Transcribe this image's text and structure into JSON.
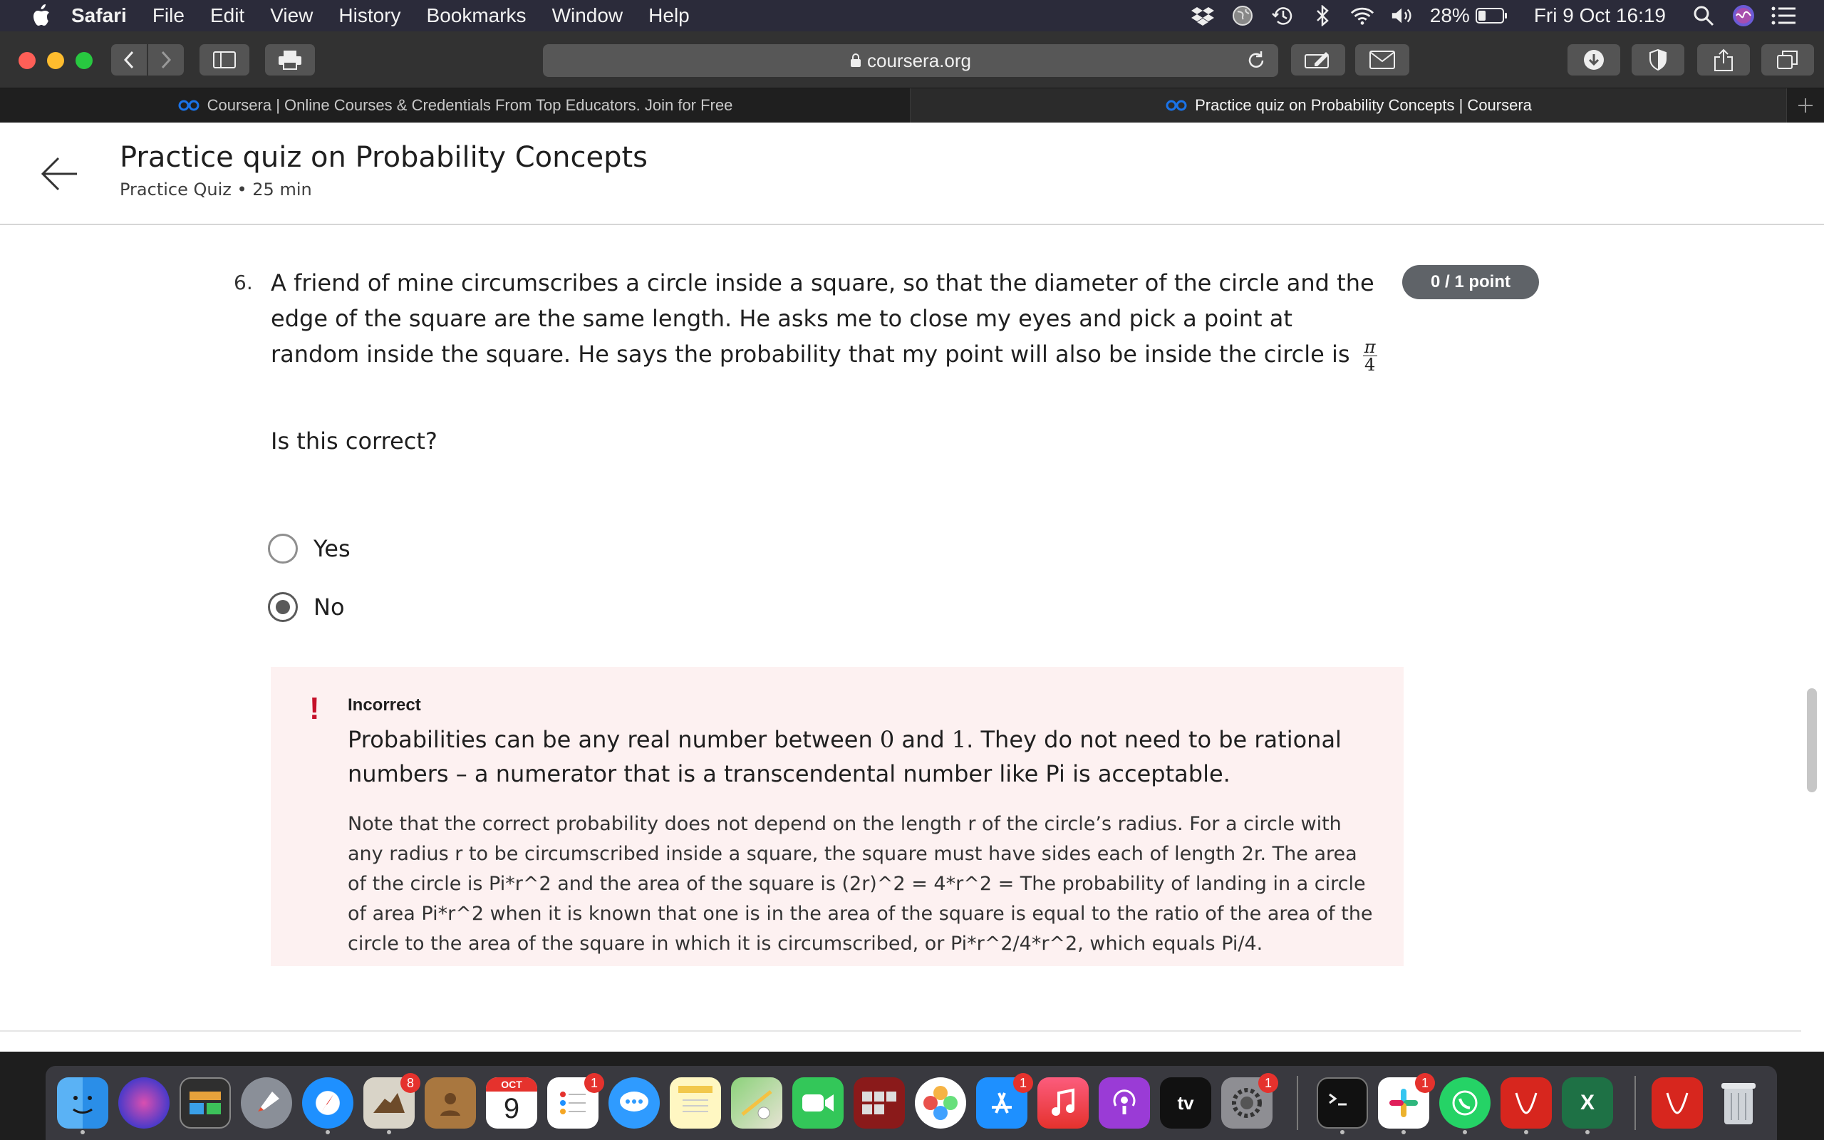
{
  "menubar": {
    "app": "Safari",
    "items": [
      "File",
      "Edit",
      "View",
      "History",
      "Bookmarks",
      "Window",
      "Help"
    ],
    "battery": "28%",
    "datetime": "Fri 9 Oct  16:19"
  },
  "browser": {
    "url": "coursera.org",
    "tabs": [
      {
        "title": "Coursera | Online Courses & Credentials From Top Educators. Join for Free",
        "active": false
      },
      {
        "title": "Practice quiz on Probability Concepts | Coursera",
        "active": true
      }
    ]
  },
  "header": {
    "title": "Practice quiz on Probability Concepts",
    "subtitle": "Practice Quiz • 25 min"
  },
  "question": {
    "number": "6.",
    "text": "A friend of mine circumscribes a circle inside a square, so that the diameter of the circle and the edge of the square are the same length. He asks me to close my eyes and pick a point at random inside the square. He says the probability that my point will also be inside the circle is",
    "fraction_num": "π",
    "fraction_den": "4",
    "points": "0 / 1 point",
    "prompt": "Is this correct?",
    "options": [
      {
        "label": "Yes",
        "selected": false
      },
      {
        "label": "No",
        "selected": true
      }
    ]
  },
  "feedback": {
    "status": "Incorrect",
    "main_a": "Probabilities can be any real number between ",
    "zero": "0",
    "main_b": " and ",
    "one": "1",
    "main_c": ". They do not need to be rational numbers – a numerator that is a transcendental number like Pi is acceptable.",
    "note": "Note that the correct probability does not depend on the length r of the circle’s radius. For a circle with any radius r to be circumscribed inside a square, the square must have sides each of length 2r. The area of the circle is Pi*r^2 and the area of the square is (2r)^2 = 4*r^2 = The probability of landing in a circle of area Pi*r^2 when it is known that one is in the area of the square is equal to the ratio of the area of the circle to the area of the square in which it is circumscribed, or Pi*r^2/4*r^2, which equals Pi/4."
  },
  "dock": {
    "calendar_month": "OCT",
    "calendar_day": "9",
    "tv_label": "tv",
    "excel_label": "X",
    "badges": {
      "mail": "8",
      "reminders": "1",
      "appstore": "1",
      "sysprefs": "1",
      "slack": "1"
    }
  }
}
